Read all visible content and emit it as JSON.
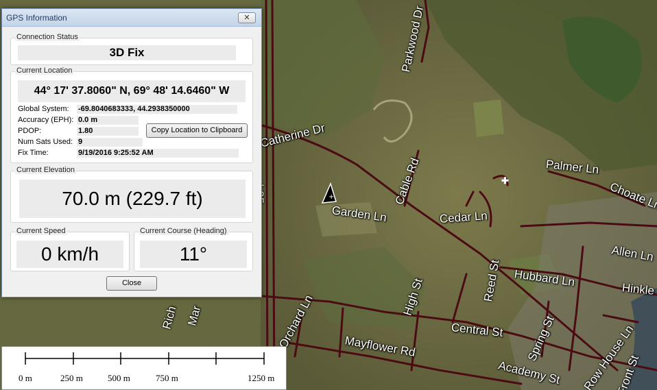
{
  "map": {
    "labels": [
      {
        "text": "Parkwood Dr",
        "name": "label-parkwood-dr"
      },
      {
        "text": "Catherine Dr",
        "name": "label-catherine-dr"
      },
      {
        "text": "Cable Rd",
        "name": "label-cable-rd"
      },
      {
        "text": "Palmer Ln",
        "name": "label-palmer-ln"
      },
      {
        "text": "Choate Ln",
        "name": "label-choate-ln"
      },
      {
        "text": "I-95",
        "name": "label-i95"
      },
      {
        "text": "Garden Ln",
        "name": "label-garden-ln"
      },
      {
        "text": "Cedar Ln",
        "name": "label-cedar-ln"
      },
      {
        "text": "Allen Ln",
        "name": "label-allen-ln"
      },
      {
        "text": "Reed St",
        "name": "label-reed-st"
      },
      {
        "text": "Hubbard Ln",
        "name": "label-hubbard-ln"
      },
      {
        "text": "Hinkle",
        "name": "label-hinkle"
      },
      {
        "text": "High St",
        "name": "label-high-st"
      },
      {
        "text": "Orchard Ln",
        "name": "label-orchard-ln"
      },
      {
        "text": "Central St",
        "name": "label-central-st"
      },
      {
        "text": "Spring St",
        "name": "label-spring-st"
      },
      {
        "text": "Mayflower Rd",
        "name": "label-mayflower-rd"
      },
      {
        "text": "Academy St",
        "name": "label-academy-st"
      },
      {
        "text": "Row House Ln",
        "name": "label-row-house-ln"
      },
      {
        "text": "Front St",
        "name": "label-front-st"
      },
      {
        "text": "Rich",
        "name": "label-rich"
      },
      {
        "text": "Mar",
        "name": "label-mar"
      }
    ]
  },
  "dialog": {
    "title": "GPS Information",
    "close_glyph": "✕",
    "connection_status": {
      "title": "Connection Status",
      "value": "3D Fix"
    },
    "current_location": {
      "title": "Current Location",
      "coords": "44° 17' 37.8060\" N, 69° 48' 14.6460\" W",
      "global_system_label": "Global System:",
      "global_system_value": "-69.8040683333, 44.2938350000",
      "accuracy_label": "Accuracy (EPH):",
      "accuracy_value": "0.0 m",
      "pdop_label": "PDOP:",
      "pdop_value": "1.80",
      "num_sats_label": "Num Sats Used:",
      "num_sats_value": "9",
      "fix_time_label": "Fix Time:",
      "fix_time_value": "9/19/2016 9:25:52 AM",
      "copy_button": "Copy Location to Clipboard"
    },
    "current_elevation": {
      "title": "Current Elevation",
      "value": "70.0 m (229.7 ft)"
    },
    "current_speed": {
      "title": "Current Speed",
      "value": "0 km/h"
    },
    "current_course": {
      "title": "Current Course (Heading)",
      "value": "11°"
    },
    "close_button": "Close"
  },
  "scalebar": {
    "ticks": [
      "0 m",
      "250 m",
      "500 m",
      "750 m",
      "1250 m"
    ]
  },
  "colors": {
    "road": "#4a0b12",
    "dialog_bg": "#f0f0f0",
    "field_bg": "#ebebeb"
  }
}
